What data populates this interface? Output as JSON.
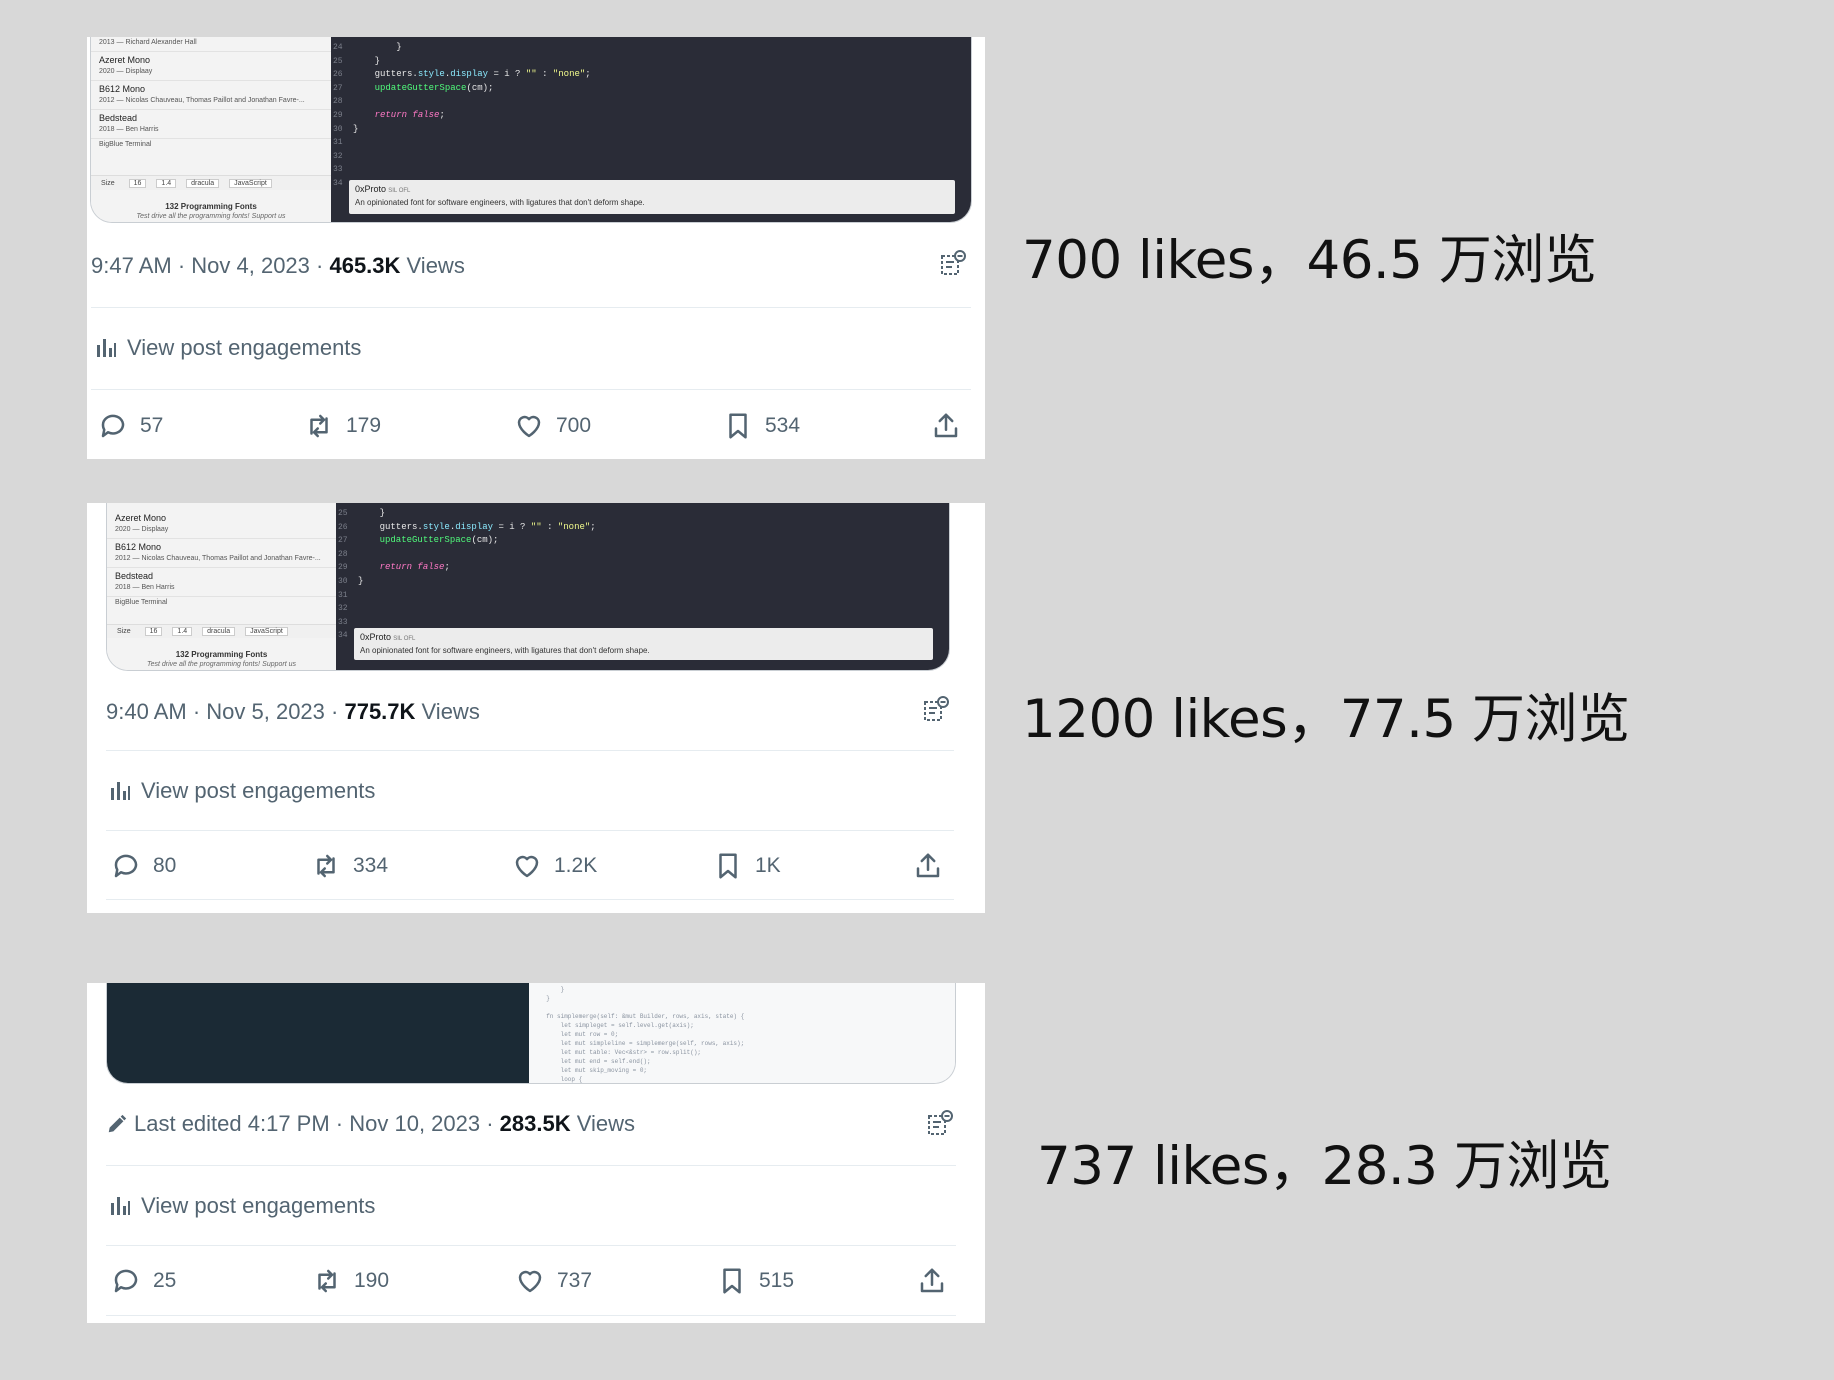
{
  "posts": [
    {
      "screenshot": {
        "fonts": [
          {
            "name": "",
            "sub": "2013 — Richard Alexander Hall"
          },
          {
            "name": "Azeret Mono",
            "sub": "2020 — Displaay"
          },
          {
            "name": "B612 Mono",
            "sub": "2012 — Nicolas Chauveau, Thomas Paillot and Jonathan Favre-..."
          },
          {
            "name": "Bedstead",
            "sub": "2018 — Ben Harris"
          }
        ],
        "cut_entry": "BigBlue Terminal",
        "controls": {
          "size_label": "Size",
          "size": "16",
          "line_height": "1.4",
          "theme": "dracula",
          "lang": "JavaScript"
        },
        "footer_title": "132 Programming Fonts",
        "footer_tag": "Test drive all the programming fonts!",
        "footer_support": "Support us",
        "gutter": [
          "24",
          "25",
          "26",
          "27",
          "28",
          "29",
          "30",
          "31",
          "32",
          "33",
          "34"
        ],
        "tooltip_name": "0xProto",
        "tooltip_license": "SIL OFL",
        "tooltip_desc": "An opinionated font for software engineers, with ligatures that don't deform shape."
      },
      "meta_prefix": "",
      "time_date": "9:47 AM · Nov 4, 2023 · ",
      "views_count": "465.3K",
      "views_label": " Views",
      "engagements_label": "View post engagements",
      "replies": "57",
      "reposts": "179",
      "likes": "700",
      "bookmarks": "534"
    },
    {
      "screenshot": {
        "fonts": [
          {
            "name": "Azeret Mono",
            "sub": "2020 — Displaay"
          },
          {
            "name": "B612 Mono",
            "sub": "2012 — Nicolas Chauveau, Thomas Paillot and Jonathan Favre-..."
          },
          {
            "name": "Bedstead",
            "sub": "2018 — Ben Harris"
          }
        ],
        "cut_entry": "BigBlue Terminal",
        "controls": {
          "size_label": "Size",
          "size": "16",
          "line_height": "1.4",
          "theme": "dracula",
          "lang": "JavaScript"
        },
        "footer_title": "132 Programming Fonts",
        "footer_tag": "Test drive all the programming fonts!",
        "footer_support": "Support us",
        "gutter": [
          "25",
          "26",
          "27",
          "28",
          "29",
          "30",
          "31",
          "32",
          "33",
          "34"
        ],
        "tooltip_name": "0xProto",
        "tooltip_license": "SIL OFL",
        "tooltip_desc": "An opinionated font for software engineers, with ligatures that don't deform shape."
      },
      "meta_prefix": "",
      "time_date": "9:40 AM · Nov 5, 2023 · ",
      "views_count": "775.7K",
      "views_label": " Views",
      "engagements_label": "View post engagements",
      "replies": "80",
      "reposts": "334",
      "likes": "1.2K",
      "bookmarks": "1K"
    },
    {
      "meta_prefix": "Last edited ",
      "time_date": "4:17 PM · Nov 10, 2023 · ",
      "views_count": "283.5K",
      "views_label": " Views",
      "engagements_label": "View post engagements",
      "replies": "25",
      "reposts": "190",
      "likes": "737",
      "bookmarks": "515"
    }
  ],
  "notes": [
    "700 likes，46.5 万浏览",
    "1200 likes，77.5 万浏览",
    "737 likes，28.3 万浏览"
  ],
  "colors": {
    "background": "#d8d8d8",
    "card": "#ffffff",
    "muted_text": "#536471",
    "code_bg": "#2a2c37"
  },
  "icons": [
    "reply-icon",
    "repost-icon",
    "like-icon",
    "bookmark-icon",
    "share-icon",
    "analytics-icon",
    "grok-icon",
    "edit-pencil-icon"
  ]
}
